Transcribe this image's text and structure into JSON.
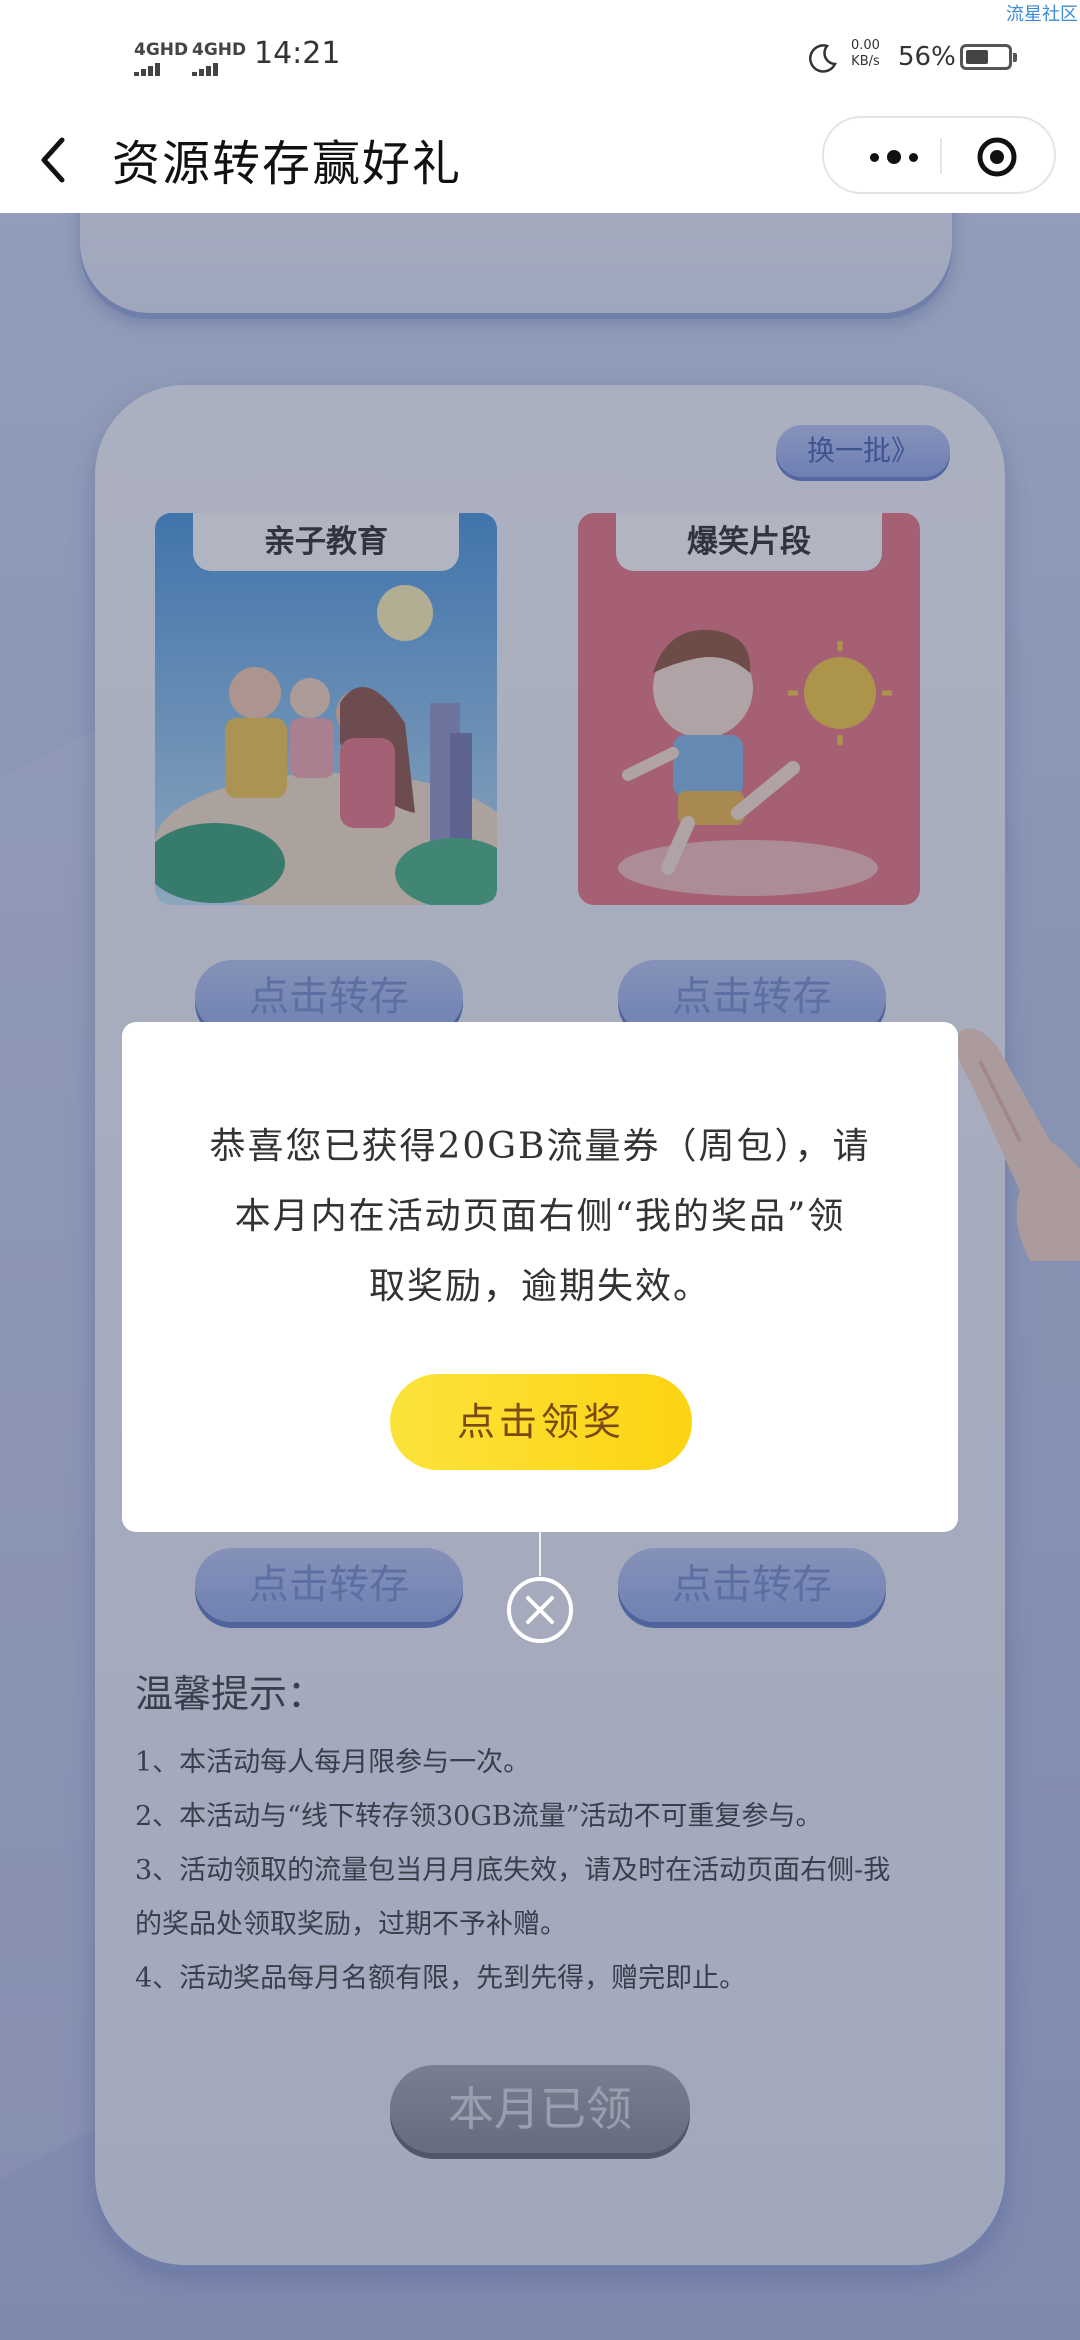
{
  "status_bar": {
    "signal1": "4GHD",
    "signal2": "4GHD",
    "time": "14:21",
    "net_speed_value": "0.00",
    "net_speed_unit": "KB/s",
    "battery_percent": "56%",
    "battery_level": 0.56,
    "watermark": "流星社区"
  },
  "nav": {
    "title": "资源转存赢好礼",
    "back_icon": "chevron-left-icon",
    "more_icon": "more-dots-icon",
    "close_icon": "target-circle-icon"
  },
  "page": {
    "swap_label": "换一批》",
    "cards": [
      {
        "tag": "亲子教育"
      },
      {
        "tag": "爆笑片段"
      }
    ],
    "save_buttons": [
      "点击转存",
      "点击转存",
      "点击转存",
      "点击转存"
    ],
    "tips_title": "温馨提示：",
    "tips": [
      "1、本活动每人每月限参与一次。",
      "2、本活动与“线下转存领30GB流量”活动不可重复参与。",
      "3、活动领取的流量包当月月底失效，请及时在活动页面右侧-我",
      "的奖品处领取奖励，过期不予补赠。",
      "4、活动奖品每月名额有限，先到先得，赠完即止。"
    ],
    "claimed_label": "本月已领"
  },
  "modal": {
    "message_line1": "恭喜您已获得20GB流量券（周包），请",
    "message_line2": "本月内在活动页面右侧“我的奖品”领",
    "message_line3": "取奖励，逾期失效。",
    "claim_label": "点击领奖",
    "close_icon": "close-circle-icon"
  },
  "colors": {
    "claim_button": "#fdd312",
    "page_bg": "#b9c5e6",
    "accent_blue": "#8da2e6"
  }
}
